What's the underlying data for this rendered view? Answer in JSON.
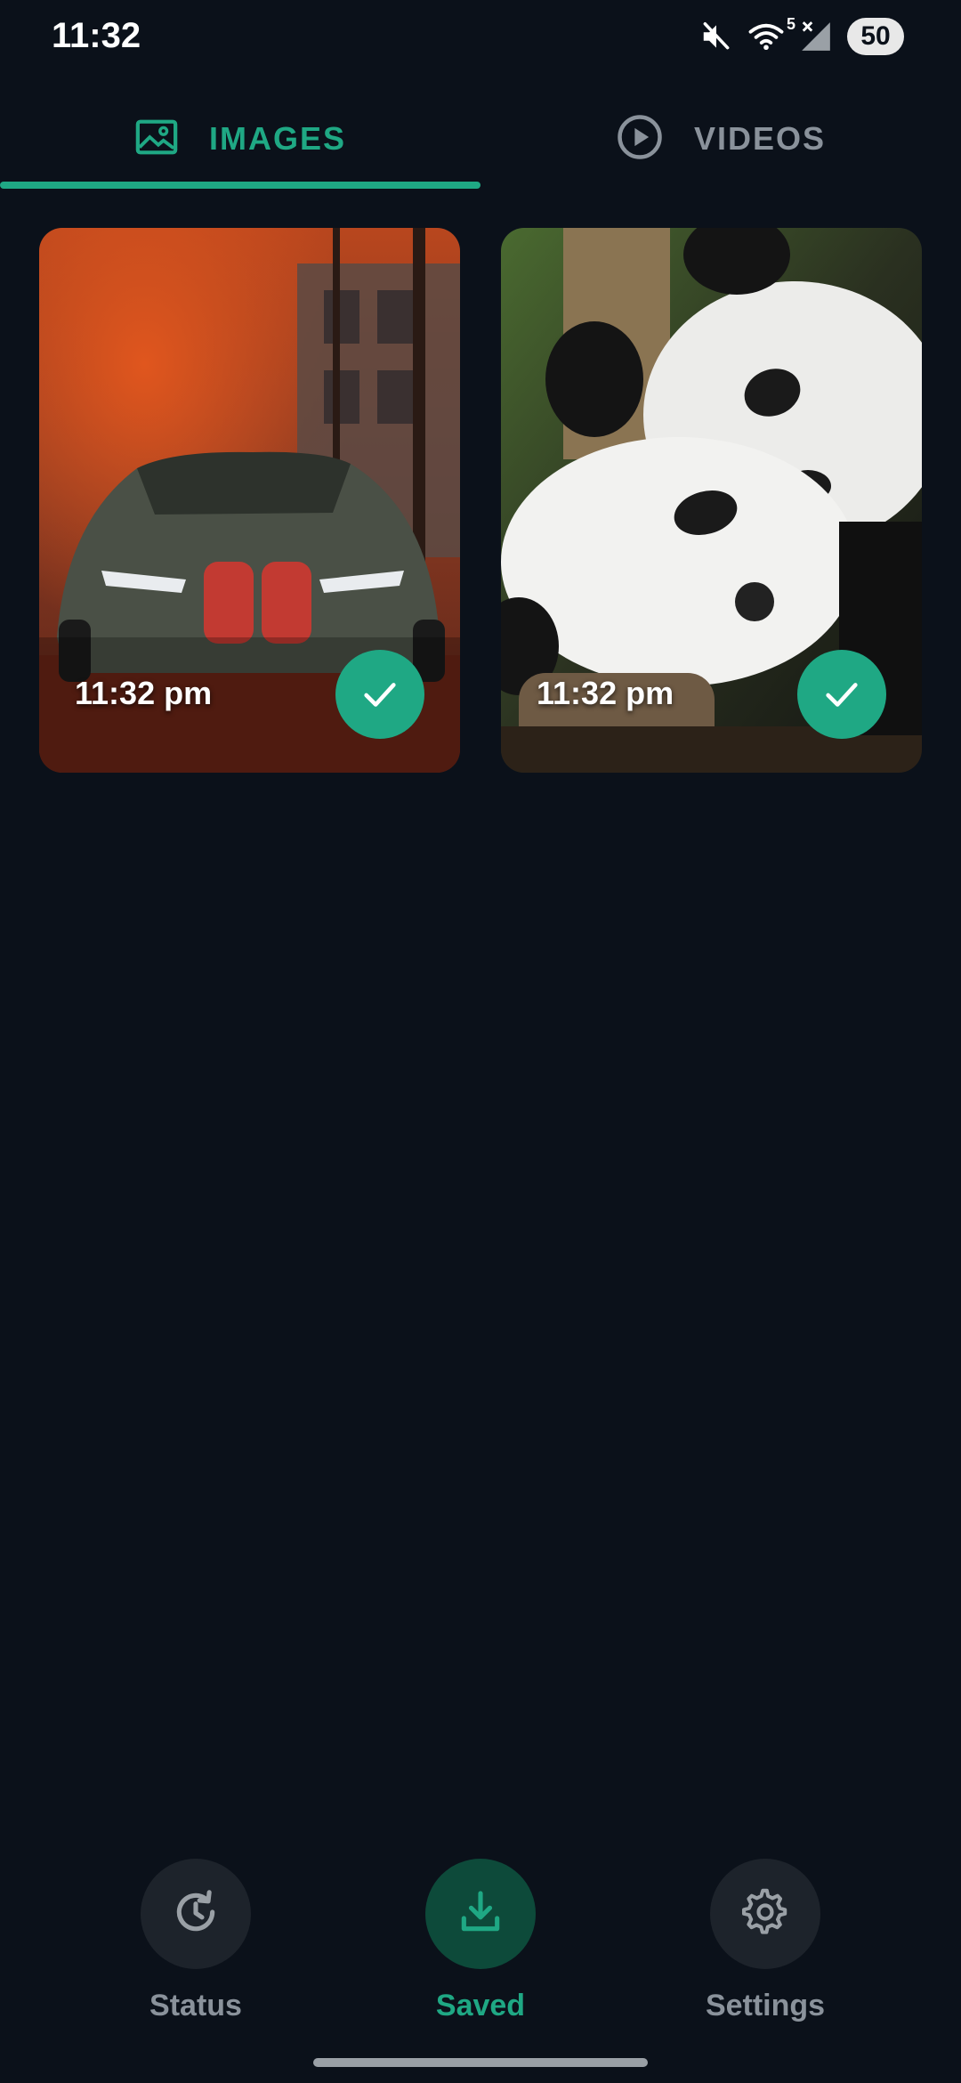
{
  "status_bar": {
    "time": "11:32",
    "wifi_badge": "5",
    "battery": "50",
    "icons": [
      "mute-icon",
      "wifi-icon",
      "signal-icon",
      "battery-icon"
    ]
  },
  "tabs": [
    {
      "label": "IMAGES",
      "icon": "image-icon",
      "active": true
    },
    {
      "label": "VIDEOS",
      "icon": "play-circle-icon",
      "active": false
    }
  ],
  "items": [
    {
      "time": "11:32 pm",
      "subject": "car",
      "selected": true
    },
    {
      "time": "11:32 pm",
      "subject": "pandas",
      "selected": true
    }
  ],
  "nav": [
    {
      "label": "Status",
      "icon": "history-icon",
      "active": false
    },
    {
      "label": "Saved",
      "icon": "download-icon",
      "active": true
    },
    {
      "label": "Settings",
      "icon": "gear-icon",
      "active": false
    }
  ],
  "colors": {
    "background": "#0b111a",
    "accent": "#1fa884",
    "inactive": "#8a929b",
    "nav_circle": "#1d232b",
    "nav_circle_active": "#0d4a3a"
  }
}
